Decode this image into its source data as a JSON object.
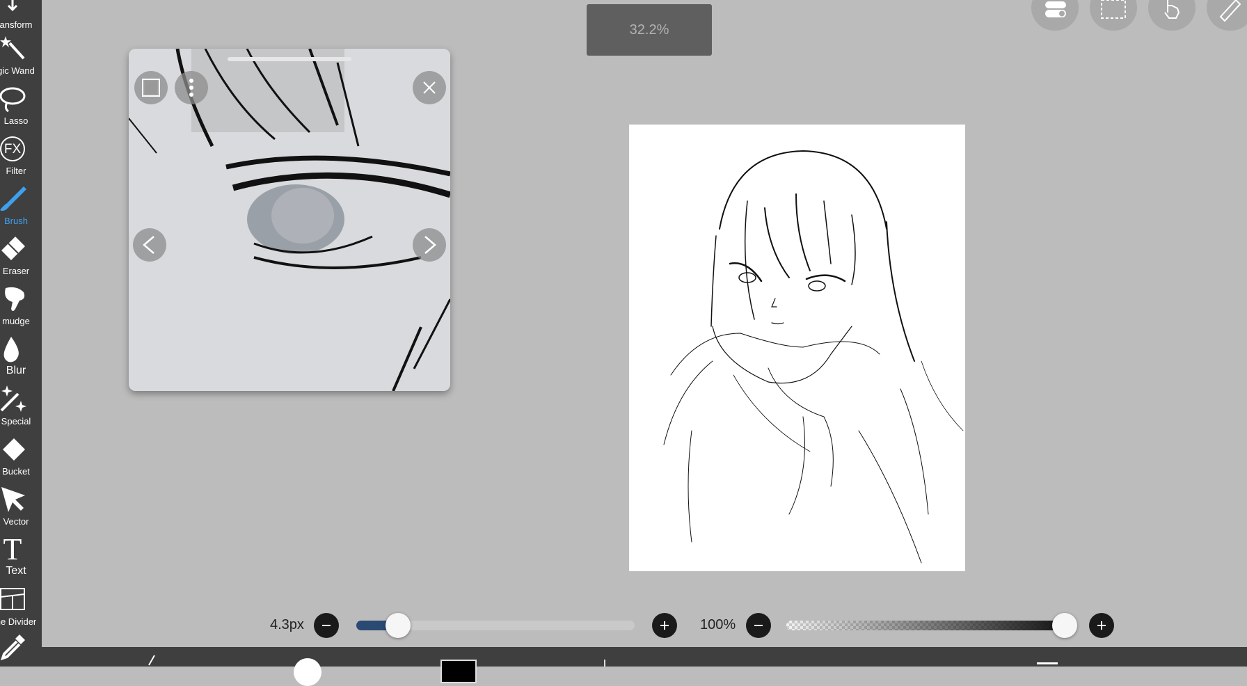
{
  "toolbar": {
    "tools": [
      {
        "label": "ansform",
        "icon": "transform-icon"
      },
      {
        "label": "gic Wand",
        "icon": "magic-wand-icon"
      },
      {
        "label": "Lasso",
        "icon": "lasso-icon"
      },
      {
        "label": "Filter",
        "icon": "fx-icon",
        "icon_text": "FX"
      },
      {
        "label": "Brush",
        "icon": "brush-icon",
        "active": true
      },
      {
        "label": "Eraser",
        "icon": "eraser-icon"
      },
      {
        "label": "mudge",
        "icon": "smudge-icon"
      },
      {
        "label": "Blur",
        "icon": "blur-drop-icon"
      },
      {
        "label": "Special",
        "icon": "special-sparkle-icon"
      },
      {
        "label": "Bucket",
        "icon": "bucket-icon"
      },
      {
        "label": "Vector",
        "icon": "vector-cursor-icon"
      },
      {
        "label": "Text",
        "icon": "text-icon",
        "icon_text": "T"
      },
      {
        "label": "ne Divider",
        "icon": "frame-divider-icon"
      },
      {
        "label": "",
        "icon": "eyedropper-icon"
      }
    ],
    "active_color": "#3fa0f0"
  },
  "zoom": {
    "label": "32.2%"
  },
  "top_right_buttons": [
    "toggle-icon",
    "selection-icon",
    "hand-icon",
    "ruler-icon"
  ],
  "reference_window": {
    "buttons": [
      "frame-icon",
      "more-icon",
      "close-icon",
      "chevron-left-icon",
      "chevron-right-icon"
    ]
  },
  "brush_size": {
    "value_label": "4.3px",
    "fraction": 0.15
  },
  "opacity": {
    "value_label": "100%",
    "fraction": 1.0
  },
  "colors": {
    "accent": "#3fa0f0",
    "slider_fill": "#2a4a73",
    "toolbar_bg": "#3f3f3f",
    "background": "#bcbcbc"
  }
}
